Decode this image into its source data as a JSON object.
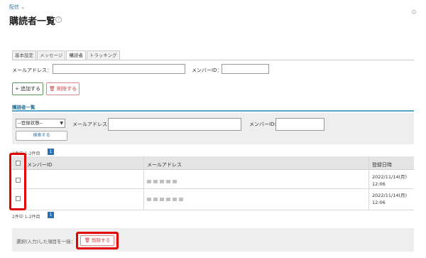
{
  "breadcrumb": "配信 ⌄",
  "page_title": "購読者一覧",
  "help_icon": "question-icon",
  "tabs": [
    {
      "label": "基本設定"
    },
    {
      "label": "メッセージ"
    },
    {
      "label": "購読者"
    },
    {
      "label": "トラッキング"
    }
  ],
  "top_form": {
    "email_label": "メールアドレス：",
    "email_value": "",
    "member_label": "メンバーID：",
    "member_value": ""
  },
  "actions": {
    "add_label": "+ 追加する",
    "delete_label": "🗑 削除する"
  },
  "list_title": "購読者一覧",
  "filter": {
    "status_selected": "--登録状態--",
    "email_label": "メールアドレス:",
    "email_value": "",
    "member_label": "メンバーID:",
    "member_value": "",
    "search_label": "検索する"
  },
  "pagination": {
    "count_text": "2件中 1-2件目",
    "page": "1"
  },
  "table": {
    "headers": [
      "",
      "メンバーID",
      "メールアドレス",
      "登録日時"
    ],
    "rows": [
      {
        "member_id": "",
        "email": "■■■■■",
        "date_line1": "2022/11/14(月)",
        "date_line2": "12:06"
      },
      {
        "member_id": "",
        "email": "■■■■■■",
        "date_line1": "2022/11/14(月)",
        "date_line2": "12:06"
      }
    ]
  },
  "bulk": {
    "label": "選択(入力)した項目を一括：",
    "delete_label": "🗑 削除する"
  },
  "colors": {
    "accent_blue": "#2a7ab0",
    "highlight_red": "#e00000",
    "delete_red": "#cc4444",
    "add_green": "#5a9a5a"
  }
}
